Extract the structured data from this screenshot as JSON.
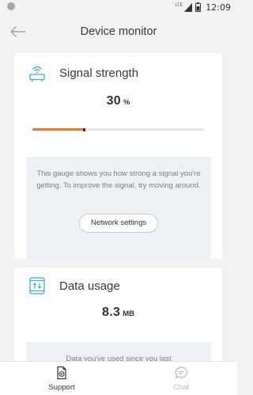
{
  "status_bar": {
    "network_label": "LTE",
    "time": "12:09",
    "icons": [
      "notification-dot-icon",
      "cellular-signal-icon",
      "battery-icon"
    ]
  },
  "header": {
    "title": "Device monitor",
    "back_icon": "arrow-left-icon"
  },
  "signal_card": {
    "icon": "router-wifi-icon",
    "title": "Signal strength",
    "value": "30",
    "unit": "%",
    "progress_fraction": 0.3,
    "progress_color": "#f07a2a",
    "info_text": "This gauge shows you how strong a signal you're getting. To improve the signal, try moving around.",
    "button_label": "Network settings"
  },
  "data_card": {
    "icon": "phone-data-icon",
    "title": "Data usage",
    "value": "8.3",
    "unit": "MB",
    "info_text": "Data you've used since you last"
  },
  "bottom_nav": {
    "items": [
      {
        "label": "Support",
        "icon": "support-document-icon",
        "active": true
      },
      {
        "label": "Chat",
        "icon": "chat-bubble-icon",
        "active": false
      }
    ]
  },
  "colors": {
    "accent": "#f07a2a",
    "icon_blue": "#3fa9dc",
    "background": "#f2f2f2",
    "info_box": "#edf1f5"
  }
}
